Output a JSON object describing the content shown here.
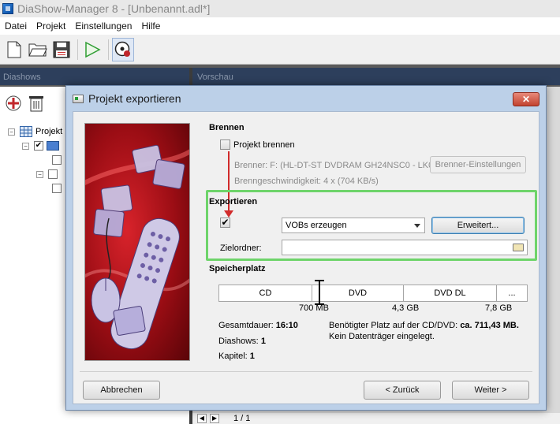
{
  "window": {
    "title": "DiaShow-Manager 8 - [Unbenannt.adl*]"
  },
  "menu": [
    "Datei",
    "Projekt",
    "Einstellungen",
    "Hilfe"
  ],
  "panels": {
    "left_header": "Diashows",
    "right_header": "Vorschau"
  },
  "tree": {
    "root_label": "Projekt"
  },
  "bottom_nav": {
    "page_indicator": "1 / 1"
  },
  "dialog": {
    "title": "Projekt exportieren",
    "close_label": "✕",
    "brennen": {
      "heading": "Brennen",
      "checkbox_label": "Projekt brennen",
      "brenner": "Brenner: F: (HL-DT-ST DVDRAM GH24NSC0 - LK00)",
      "geschwindigkeit": "Brenngeschwindigkeit: 4 x (704 KB/s)",
      "settings_button": "Brenner-Einstellungen"
    },
    "exportieren": {
      "heading": "Exportieren",
      "checkbox_mark": "✔",
      "format_selected": "VOBs erzeugen",
      "advanced_button": "Erweitert...",
      "folder_label": "Zielordner:",
      "folder_value": ""
    },
    "speicherplatz": {
      "heading": "Speicherplatz",
      "segments": [
        "CD",
        "DVD",
        "DVD DL",
        "..."
      ],
      "ticks": [
        "700 MB",
        "4,3 GB",
        "7,8 GB"
      ],
      "gesamtdauer_label": "Gesamtdauer:",
      "gesamtdauer_value": "16:10",
      "diashows_label": "Diashows:",
      "diashows_value": "1",
      "kapitel_label": "Kapitel:",
      "kapitel_value": "1",
      "platz_label": "Benötigter Platz auf der CD/DVD:",
      "platz_value": "ca. 711,43 MB.",
      "datentraeger": "Kein Datenträger eingelegt."
    },
    "footer": {
      "cancel": "Abbrechen",
      "back": "< Zurück",
      "next": "Weiter >"
    }
  },
  "colors": {
    "highlight": "#6ed46a",
    "annotation_arrow": "#d12b2b",
    "dialog_frame": "#bcd0e8"
  }
}
